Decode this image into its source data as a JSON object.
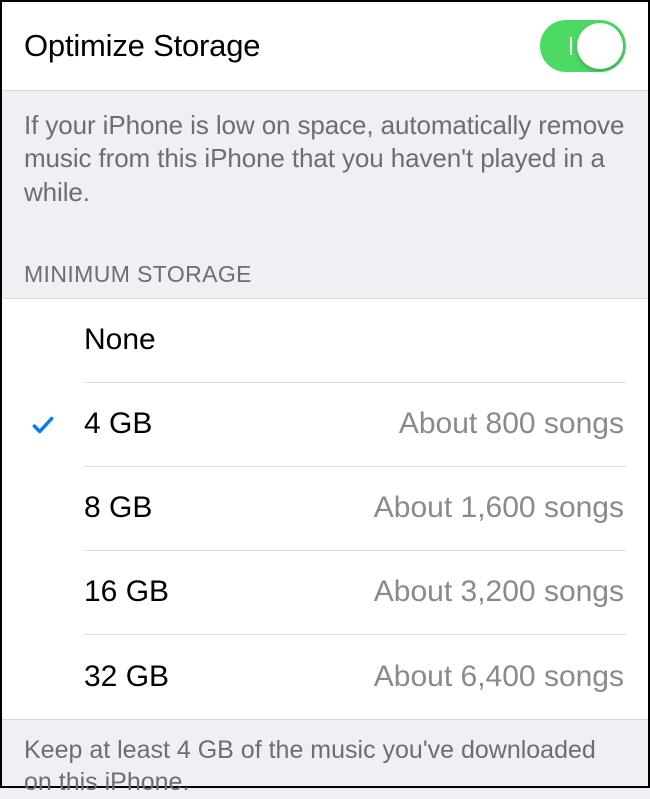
{
  "toggle": {
    "label": "Optimize Storage",
    "on": true
  },
  "description": "If your iPhone is low on space, automatically remove music from this iPhone that you haven't played in a while.",
  "section_header": "MINIMUM STORAGE",
  "options": [
    {
      "label": "None",
      "sub": "",
      "selected": false
    },
    {
      "label": "4 GB",
      "sub": "About 800 songs",
      "selected": true
    },
    {
      "label": "8 GB",
      "sub": "About 1,600 songs",
      "selected": false
    },
    {
      "label": "16 GB",
      "sub": "About 3,200 songs",
      "selected": false
    },
    {
      "label": "32 GB",
      "sub": "About 6,400 songs",
      "selected": false
    }
  ],
  "footer": "Keep at least 4 GB of the music you've downloaded on this iPhone."
}
